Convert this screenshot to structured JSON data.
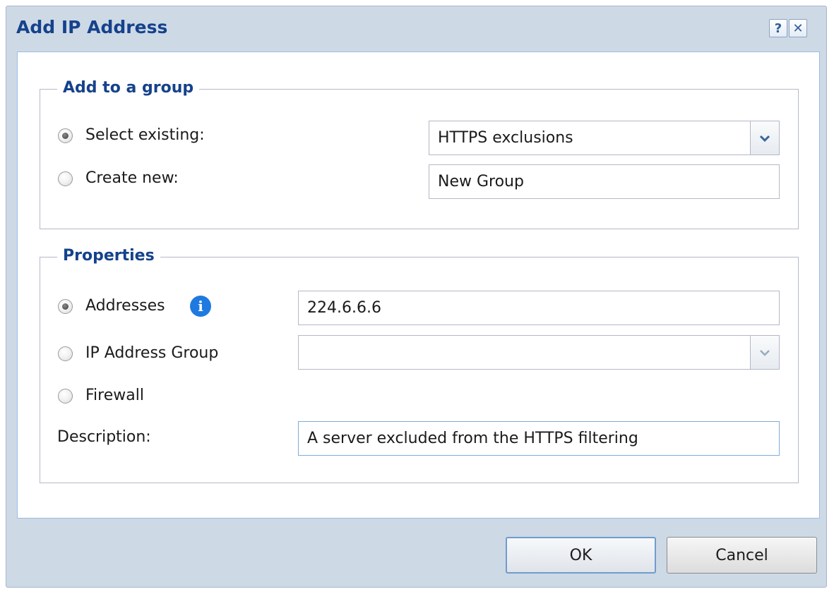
{
  "dialog": {
    "title": "Add IP Address",
    "help_icon": "?",
    "close_icon": "✕"
  },
  "group_section": {
    "legend": "Add to a group",
    "select_existing_label": "Select existing:",
    "select_existing_checked": true,
    "select_existing_value": "HTTPS exclusions",
    "create_new_label": "Create new:",
    "create_new_checked": false,
    "create_new_value": "New Group"
  },
  "properties_section": {
    "legend": "Properties",
    "addresses_label": "Addresses",
    "addresses_checked": true,
    "addresses_value": "224.6.6.6",
    "info_icon": "i",
    "ip_group_label": "IP Address Group",
    "ip_group_checked": false,
    "ip_group_value": "",
    "firewall_label": "Firewall",
    "firewall_checked": false,
    "description_label": "Description:",
    "description_value": "A server excluded from the HTTPS filtering"
  },
  "buttons": {
    "ok": "OK",
    "cancel": "Cancel"
  },
  "colors": {
    "title_text": "#15428b",
    "frame": "#ced9e6",
    "info_icon": "#1e7ae0",
    "focus_border": "#7eadd9"
  },
  "icons": {
    "help": "help-icon",
    "close": "close-icon",
    "dropdown": "chevron-down-icon",
    "info": "info-icon"
  }
}
